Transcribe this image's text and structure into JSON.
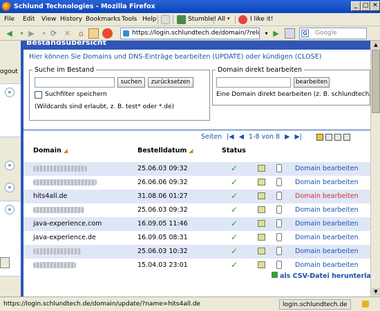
{
  "window": {
    "title": "Schlund Technologies - Mozilla Firefox",
    "minimize": "_",
    "maximize": "□",
    "close": "✕"
  },
  "menu": {
    "items": [
      "File",
      "Edit",
      "View",
      "History",
      "Bookmarks",
      "Tools",
      "Help"
    ],
    "stumble": "Stumble!",
    "all": "All",
    "ilike": "I like it!"
  },
  "nav": {
    "url": "https://login.schlundtech.de/domain/?relo",
    "search_placeholder": "Google",
    "back": "◀",
    "forward": "▶",
    "reload": "⟳",
    "stop": "✕",
    "home": "⌂",
    "go": "▶"
  },
  "sidebar": {
    "logout": "ogout"
  },
  "page": {
    "header": "Bestandsübersicht",
    "intro": "Hier können Sie Domains und DNS-Einträge bearbeiten (UPDATE) oder kündigen (CLOSE)",
    "search": {
      "legend": "Suche im Bestand",
      "search_btn": "suchen",
      "reset_btn": "zurücksetzen",
      "save_filter": "Suchfilter speichern",
      "hint": "(Wildcards sind erlaubt, z. B. test* oder *.de)"
    },
    "direct": {
      "legend": "Domain direkt bearbeiten",
      "edit_btn": "bearbeiten",
      "hint": "Eine Domain direkt bearbeiten (z. B. schlundtech.de)"
    },
    "pager": {
      "label": "Seiten",
      "range": "1-8 von 8"
    },
    "table": {
      "headers": {
        "domain": "Domain",
        "date": "Bestelldatum",
        "status": "Status"
      },
      "rows": [
        {
          "domain": "",
          "blurred": true,
          "blur_w": 78,
          "date": "25.06.03 09:32",
          "link": "Domain bearbeiten",
          "highlight": false
        },
        {
          "domain": "",
          "blurred": true,
          "blur_w": 92,
          "date": "26.06.06 09:32",
          "link": "Domain bearbeiten",
          "highlight": false
        },
        {
          "domain": "hits4all.de",
          "blurred": false,
          "date": "31.08.06 01:27",
          "link": "Domain bearbeiten",
          "highlight": true
        },
        {
          "domain": "",
          "blurred": true,
          "blur_w": 74,
          "date": "25.06.03 09:32",
          "link": "Domain bearbeiten",
          "highlight": false
        },
        {
          "domain": "java-experience.com",
          "blurred": false,
          "date": "16.09.05 11:46",
          "link": "Domain bearbeiten",
          "highlight": false
        },
        {
          "domain": "java-experience.de",
          "blurred": false,
          "date": "16.09.05 08:31",
          "link": "Domain bearbeiten",
          "highlight": false
        },
        {
          "domain": "",
          "blurred": true,
          "blur_w": 70,
          "date": "25.06.03 10:32",
          "link": "Domain bearbeiten",
          "highlight": false
        },
        {
          "domain": "",
          "blurred": true,
          "blur_w": 62,
          "date": "15.04.03 23:01",
          "link": "Domain bearbeiten",
          "highlight": false
        }
      ]
    },
    "csv": "als CSV-Datei herunterladen"
  },
  "status": {
    "url": "https://login.schlundtech.de/domain/update/?name=hits4all.de",
    "host": "login.schlundtech.de"
  },
  "colors": {
    "accent": "#2f55b7",
    "link": "#1a4faa",
    "highlight_link": "#d03030",
    "row_alt": "#dfe7f7",
    "status_ok": "#2e9a2e"
  }
}
